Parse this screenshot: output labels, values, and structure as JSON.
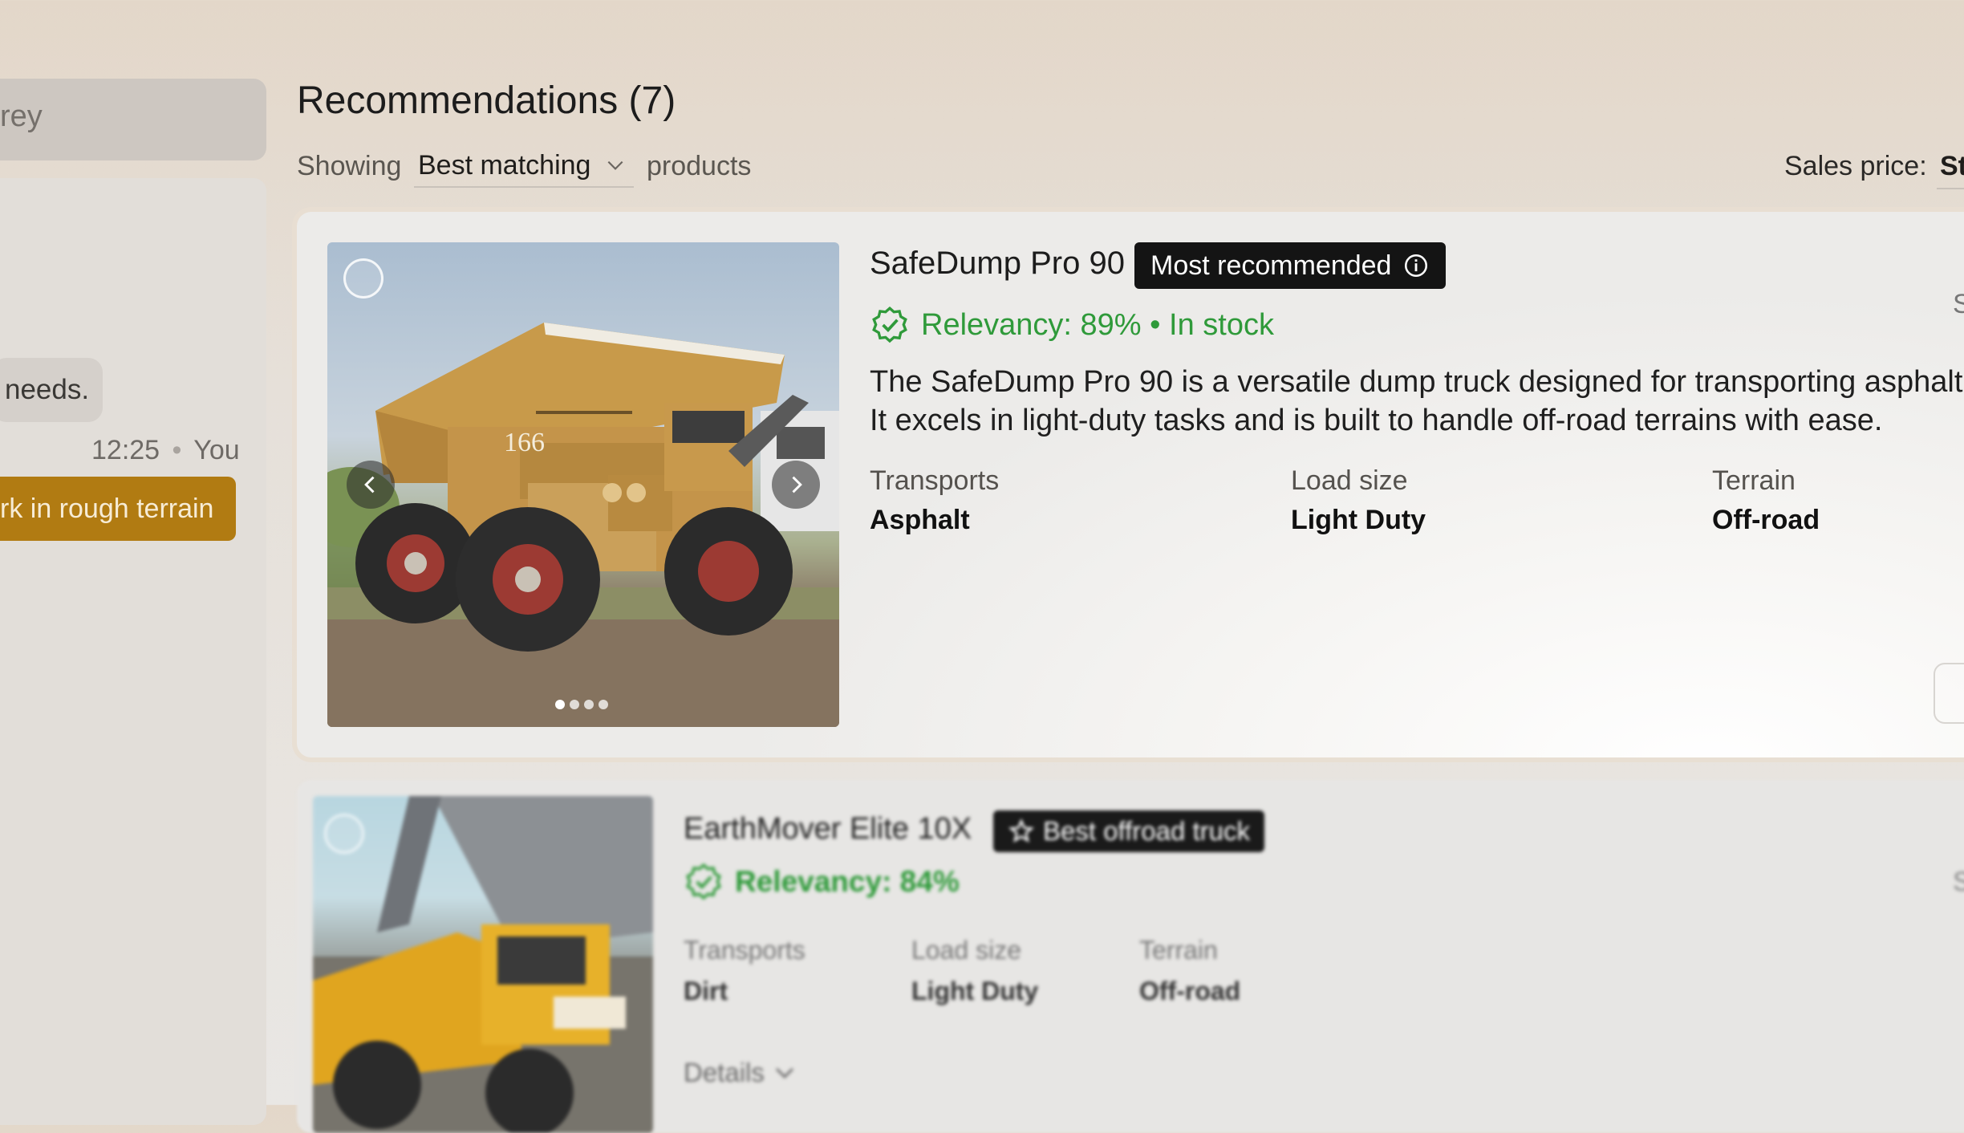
{
  "sidebar": {
    "survey_partial": "rey",
    "messages": [
      {
        "text": "needs."
      },
      {
        "time": "12:25",
        "sender": "You",
        "text": "rk in rough terrain"
      }
    ]
  },
  "header": {
    "title": "Recommendations (7)",
    "showing_label": "Showing",
    "sort_value": "Best matching",
    "products_label": "products",
    "price_label": "Sales price:",
    "price_value": "St"
  },
  "products": [
    {
      "name": "SafeDump Pro 90",
      "badge": "Most recommended",
      "relevancy": "Relevancy: 89% • In stock",
      "description": "The SafeDump Pro 90 is a versatile dump truck designed for transporting asphalt. It excels in light-duty tasks and is built to handle off-road terrains with ease.",
      "attributes": [
        {
          "label": "Transports",
          "value": "Asphalt"
        },
        {
          "label": "Load size",
          "value": "Light Duty"
        },
        {
          "label": "Terrain",
          "value": "Off-road"
        }
      ],
      "truck_number": "166",
      "side_cut": "S",
      "image_dots": 4,
      "active_dot": 0
    },
    {
      "name": "EarthMover Elite 10X",
      "badge": "Best offroad truck",
      "relevancy": "Relevancy: 84%",
      "attributes": [
        {
          "label": "Transports",
          "value": "Dirt"
        },
        {
          "label": "Load size",
          "value": "Light Duty"
        },
        {
          "label": "Terrain",
          "value": "Off-road"
        }
      ],
      "details_label": "Details",
      "side_cut": "S"
    }
  ],
  "colors": {
    "accent_user_bubble": "#b17b12",
    "relevancy_green": "#2f9a3a",
    "badge_bg": "#141414"
  },
  "icons": [
    "chevron-down-icon",
    "info-icon",
    "verified-badge-icon",
    "chevron-left-icon",
    "chevron-right-icon",
    "star-icon"
  ]
}
